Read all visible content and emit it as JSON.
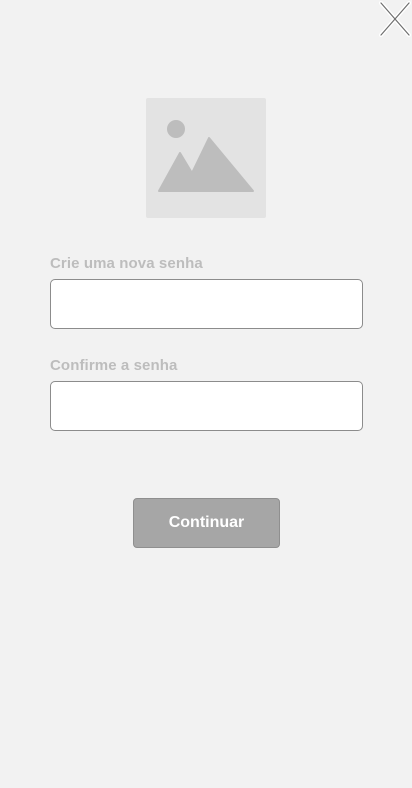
{
  "header": {
    "close_icon": "close-icon"
  },
  "illustration": {
    "icon": "image-placeholder-icon"
  },
  "form": {
    "new_password_label": "Crie uma nova senha",
    "new_password_value": "",
    "confirm_password_label": "Confirme a senha",
    "confirm_password_value": ""
  },
  "actions": {
    "continue_label": "Continuar"
  },
  "colors": {
    "background": "#f2f2f2",
    "label": "#bdbdbd",
    "button": "#a6a6a6",
    "input_border": "#8c8c8c"
  }
}
